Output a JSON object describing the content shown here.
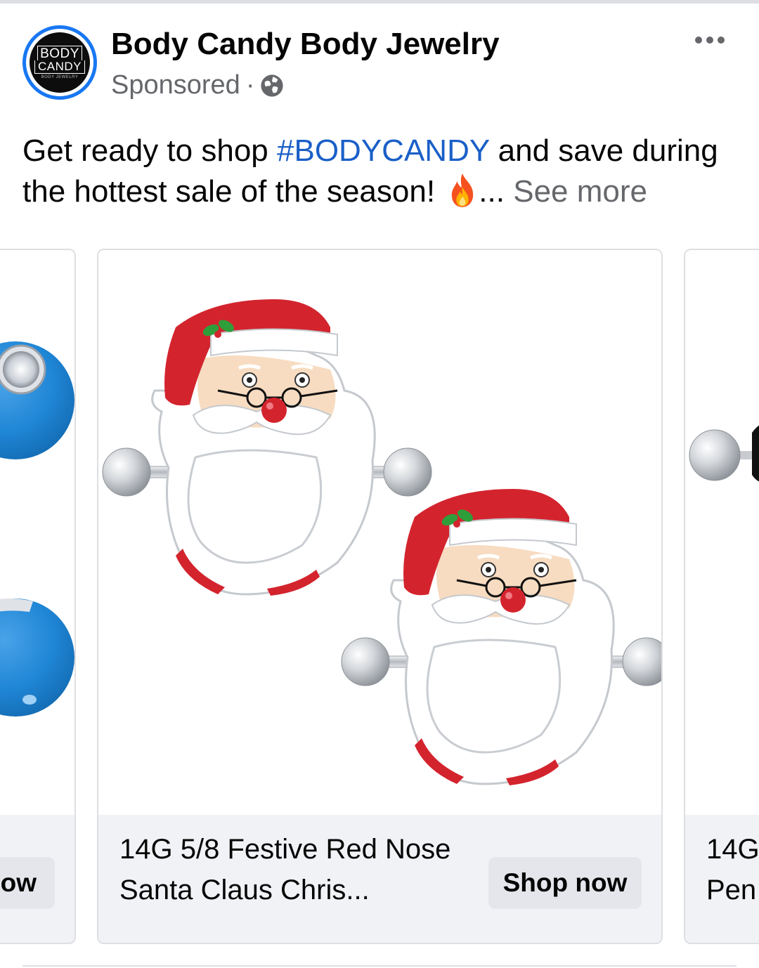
{
  "post": {
    "page_name": "Body Candy Body Jewelry",
    "sponsored_label": "Sponsored",
    "meta_separator": "·",
    "privacy_icon": "globe-icon",
    "more_icon": "more-options-icon",
    "text_before": "Get ready to shop ",
    "hashtag": "#BODYCANDY",
    "text_after": " and save during the hottest sale of the season! ",
    "emoji": "fire-emoji",
    "ellipsis": "...",
    "see_more": "See more"
  },
  "avatar": {
    "line1": "BODY",
    "line2": "CANDY",
    "line3": "BODY JEWELRY",
    "ring_color": "#1877f2"
  },
  "carousel": {
    "left_card": {
      "button_label": "Shop now",
      "image": "blue-gem-belly-ring"
    },
    "main_card": {
      "title": "14G 5/8 Festive Red Nose Santa Claus Chris...",
      "button_label": "Shop now",
      "image": "santa-claus-nipple-rings"
    },
    "right_card": {
      "title": "14G\nPen",
      "image": "black-barbell-jewelry"
    }
  },
  "colors": {
    "hashtag": "#1a5fc8",
    "secondary_text": "#65676b",
    "footer_bg": "#f0f2f5",
    "button_bg": "#e4e6eb"
  }
}
